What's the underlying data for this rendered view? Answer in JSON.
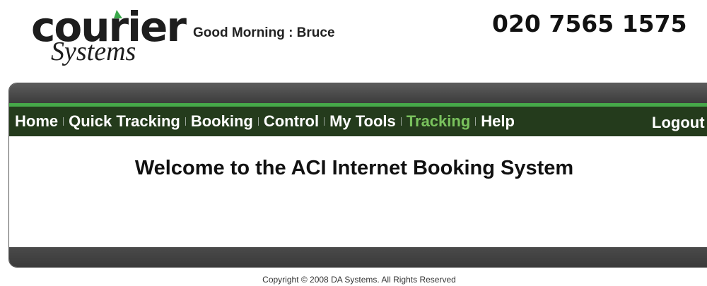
{
  "header": {
    "logo": {
      "word": "courier",
      "sub": "Systems"
    },
    "greeting": "Good Morning : Bruce",
    "phone": "020 7565 1575"
  },
  "nav": {
    "items": [
      {
        "label": "Home"
      },
      {
        "label": "Quick Tracking"
      },
      {
        "label": "Booking"
      },
      {
        "label": "Control"
      },
      {
        "label": "My Tools"
      },
      {
        "label": "Tracking",
        "active": true
      },
      {
        "label": "Help"
      }
    ],
    "logout_label": "Logout",
    "active_color": "#79c25d",
    "bar_color": "#243b1c",
    "accent_green": "#46a849"
  },
  "main": {
    "welcome": "Welcome to the ACI Internet Booking System"
  },
  "footer": {
    "copyright": "Copyright © 2008 DA Systems. All Rights Reserved"
  }
}
